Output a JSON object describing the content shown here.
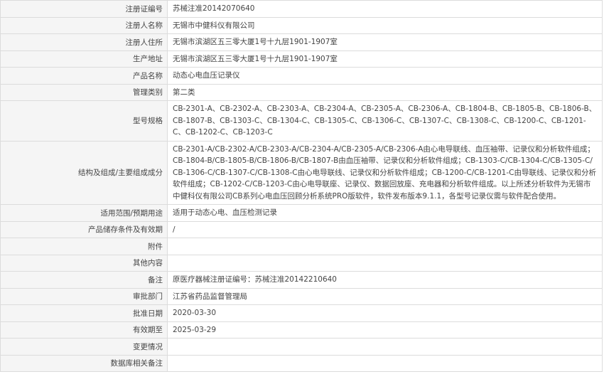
{
  "rows": [
    {
      "key": "reg-number",
      "label": "注册证编号",
      "value": "苏械注准20142070640"
    },
    {
      "key": "registrant-name",
      "label": "注册人名称",
      "value": "无锡市中健科仪有限公司"
    },
    {
      "key": "registrant-address",
      "label": "注册人住所",
      "value": "无锡市滨湖区五三零大厦1号十九层1901-1907室"
    },
    {
      "key": "production-address",
      "label": "生产地址",
      "value": "无锡市滨湖区五三零大厦1号十九层1901-1907室"
    },
    {
      "key": "product-name",
      "label": "产品名称",
      "value": "动态心电血压记录仪"
    },
    {
      "key": "management-class",
      "label": "管理类别",
      "value": "第二类"
    },
    {
      "key": "model-spec",
      "label": "型号规格",
      "value": "CB-2301-A、CB-2302-A、CB-2303-A、CB-2304-A、CB-2305-A、CB-2306-A、CB-1804-B、CB-1805-B、CB-1806-B、CB-1807-B、CB-1303-C、CB-1304-C、CB-1305-C、CB-1306-C、CB-1307-C、CB-1308-C、CB-1200-C、CB-1201-C、CB-1202-C、CB-1203-C"
    },
    {
      "key": "structure",
      "label": "结构及组成/主要组成成分",
      "value": "CB-2301-A/CB-2302-A/CB-2303-A/CB-2304-A/CB-2305-A/CB-2306-A由心电导联线、血压袖带、记录仪和分析软件组成；CB-1804-B/CB-1805-B/CB-1806-B/CB-1807-B由血压袖带、记录仪和分析软件组成；CB-1303-C/CB-1304-C/CB-1305-C/CB-1306-C/CB-1307-C/CB-1308-C由心电导联线、记录仪和分析软件组成；CB-1200-C/CB-1201-C由导联线、记录仪和分析软件组成；CB-1202-C/CB-1203-C由心电导联座、记录仪、数据回放座、充电器和分析软件组成。以上所述分析软件为无锡市中健科仪有限公司CB系列心电血压回顾分析系统PRO版软件，软件发布版本9.1.1，各型号记录仪需与软件配合使用。"
    },
    {
      "key": "scope",
      "label": "适用范围/预期用途",
      "value": "适用于动态心电、血压检测记录"
    },
    {
      "key": "storage",
      "label": "产品储存条件及有效期",
      "value": "/"
    },
    {
      "key": "attachment",
      "label": "附件",
      "value": ""
    },
    {
      "key": "other",
      "label": "其他内容",
      "value": ""
    },
    {
      "key": "remarks",
      "label": "备注",
      "value": "原医疗器械注册证编号：苏械注准20142210640"
    },
    {
      "key": "approval-dept",
      "label": "审批部门",
      "value": "江苏省药品监督管理局"
    },
    {
      "key": "approval-date",
      "label": "批准日期",
      "value": "2020-03-30"
    },
    {
      "key": "valid-until",
      "label": "有效期至",
      "value": "2025-03-29"
    },
    {
      "key": "changes",
      "label": "变更情况",
      "value": ""
    },
    {
      "key": "db-notes",
      "label": "数据库相关备注",
      "value": ""
    }
  ]
}
